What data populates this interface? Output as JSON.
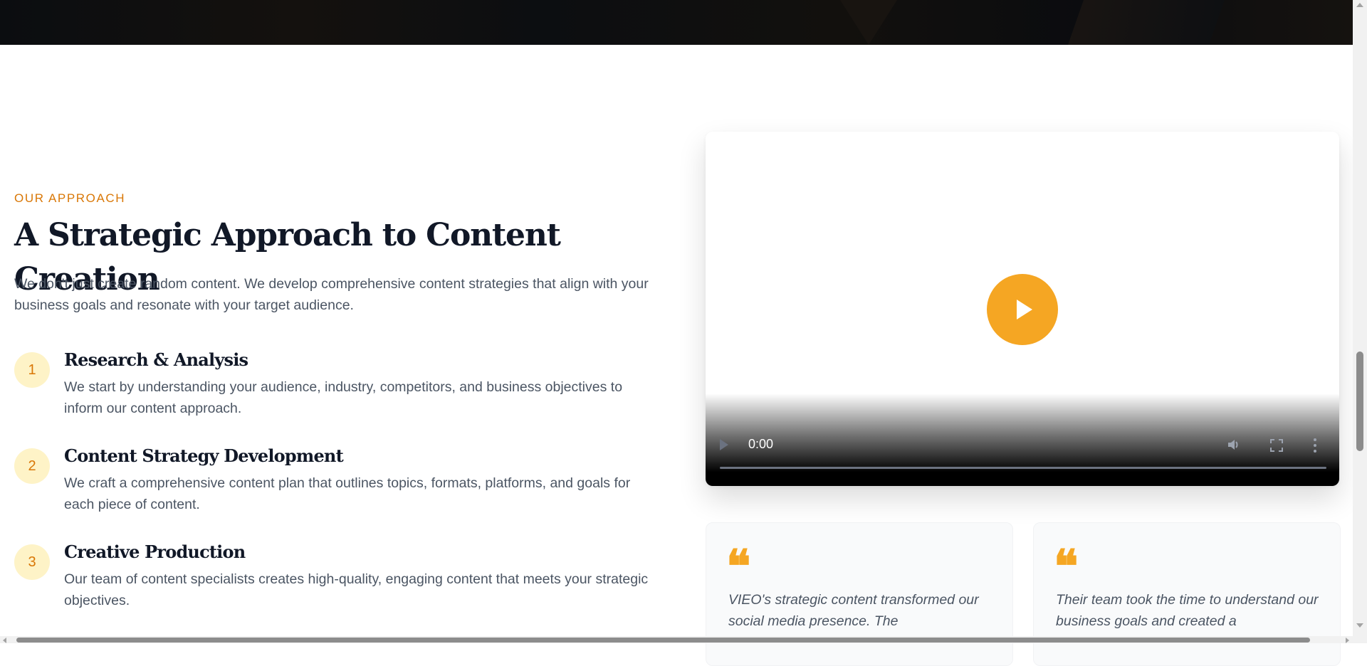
{
  "section": {
    "eyebrow": "OUR APPROACH",
    "title": "A Strategic Approach to Content Creation",
    "intro": "We don't just create random content. We develop comprehensive content strategies that align with your business goals and resonate with your target audience."
  },
  "steps": [
    {
      "number": "1",
      "title": "Research & Analysis",
      "description": "We start by understanding your audience, industry, competitors, and business objectives to inform our content approach."
    },
    {
      "number": "2",
      "title": "Content Strategy Development",
      "description": "We craft a comprehensive content plan that outlines topics, formats, platforms, and goals for each piece of content."
    },
    {
      "number": "3",
      "title": "Creative Production",
      "description": "Our team of content specialists creates high-quality, engaging content that meets your strategic objectives."
    }
  ],
  "video": {
    "time": "0:00",
    "play_icon": "play-icon",
    "volume_icon": "volume-icon",
    "fullscreen_icon": "fullscreen-icon",
    "more_icon": "more-options-icon"
  },
  "testimonials": [
    {
      "quote_mark": "❝",
      "text": "VIEO's strategic content transformed our social media presence. The"
    },
    {
      "quote_mark": "❝",
      "text": "Their team took the time to understand our business goals and created a"
    }
  ],
  "colors": {
    "accent": "#f5a623",
    "eyebrow": "#d97706",
    "step_badge_bg": "#fef3c7"
  }
}
